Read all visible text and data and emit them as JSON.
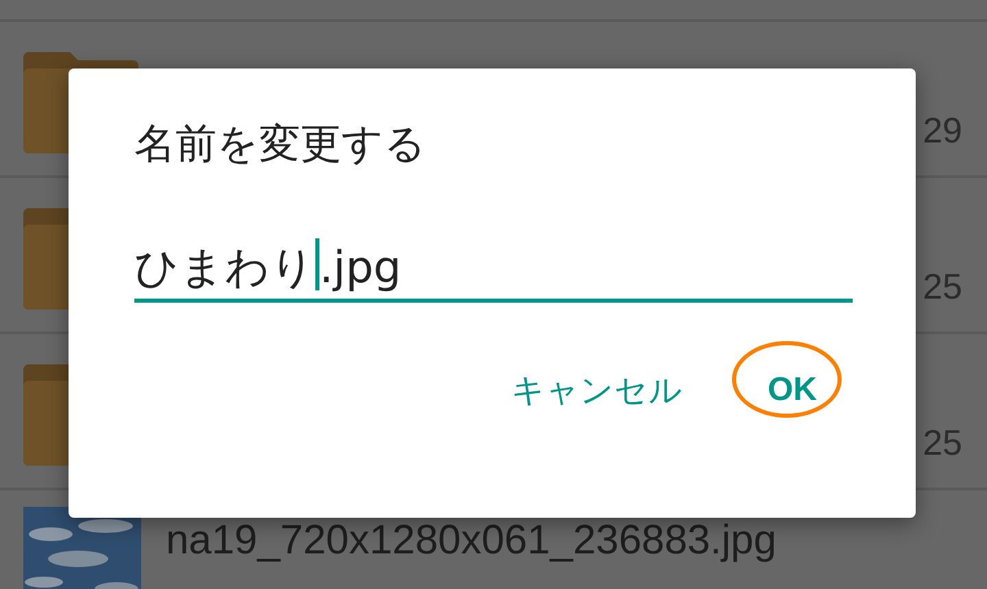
{
  "file_list": [
    {
      "kind": "partial"
    },
    {
      "kind": "folder",
      "date": "29"
    },
    {
      "kind": "folder",
      "date": "25"
    },
    {
      "kind": "folder",
      "date": "25"
    },
    {
      "name": "na19_720x1280x061_236883.jpg"
    }
  ],
  "dialog": {
    "title": "名前を変更する",
    "field": {
      "value_before_cursor": "ひまわり",
      "value_after_cursor": ".jpg"
    },
    "buttons": [
      {
        "label": "キャンセル",
        "highlighted": false
      },
      {
        "label": "OK",
        "highlighted": true
      }
    ]
  }
}
